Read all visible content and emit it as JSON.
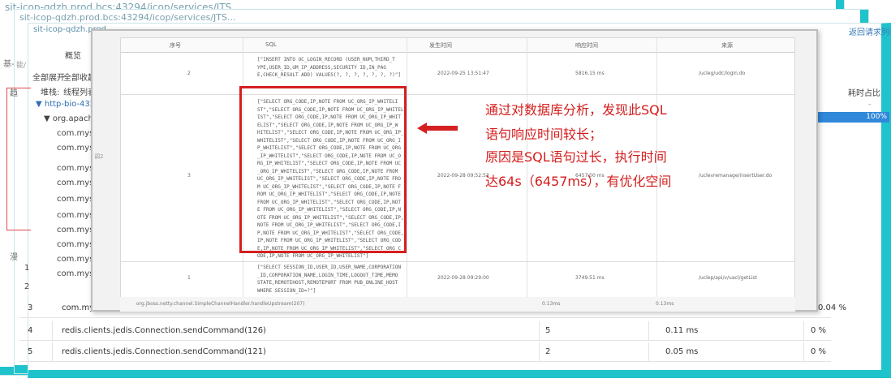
{
  "windows": {
    "w1_title": "sit-icop-qdzh.prod.bcs:43294/icop/services/JTS...",
    "w2_title": "sit-icop-qdzh.prod.bcs:43294/icop/services/JTS...",
    "w3_title": "sit-icop-qdzh.prod"
  },
  "top_right_link": "返回请求列表",
  "left": {
    "tab_label": "概览",
    "expand_all": "全部展开",
    "collapse_all": "全部收起",
    "stack_label": "堆栈:",
    "thread_list": "线程列表",
    "side_base": "基-",
    "side_le": "趋",
    "side_xs": "能/",
    "tree_root": "▼ http-bio-43290",
    "tree_child": "▼ org.apache.ca",
    "rows": [
      "com.mysql",
      "com.mysql",
      "com.mysql",
      "com.mysql",
      "com.mysql",
      "com.mysql",
      "com.mysql",
      "com.mysql",
      "com.mysql",
      "com.mysql"
    ],
    "left_bar_chars": [
      "漫",
      "1",
      "2"
    ],
    "gen_label": "返回"
  },
  "ratio": {
    "header": "耗时占比",
    "dash": "-",
    "bar_label": "100%"
  },
  "bottom_rows": [
    {
      "idx": "3",
      "name": "com.mysq",
      "count": "",
      "time": "",
      "pct": "0.04 %"
    },
    {
      "idx": "4",
      "name": "redis.clients.jedis.Connection.sendCommand(126)",
      "count": "5",
      "time": "0.11 ms",
      "pct": "0 %"
    },
    {
      "idx": "5",
      "name": "redis.clients.jedis.Connection.sendCommand(121)",
      "count": "2",
      "time": "0.05 ms",
      "pct": "0 %"
    }
  ],
  "overlay": {
    "headers": {
      "seq": "序号",
      "sql": "SQL",
      "time": "发生时间",
      "resp": "响应时间",
      "url": "来源"
    },
    "row1": {
      "seq": "2",
      "sql": "[\"INSERT INTO UC_LOGIN_RECORD (USER_NUM,THIRD_T\nYPE,USER_ID,UM_IP_ADDRESS,SECURITY ID,IN_PAG\nE,CHECK_RESULT ADD) VALUES(?, ?, ?, ?, ?, ?, ?)\"]",
      "time": "2022-09-25 13:51:47",
      "resp": "5816.15 ms",
      "url": "/ucleg/udc/logIn.do"
    },
    "row2": {
      "seq": "3",
      "sql": "[\"SELECT ORG_CODE,IP,NOTE FROM UC_ORG_IP_WHITELI\nST\",\"SELECT ORG_CODE,IP,NOTE FROM UC_ORG_IP_WHITEL\nIST\",\"SELECT ORG_CODE,IP,NOTE FROM UC_ORG_IP_WHIT\nELIST\",\"SELECT ORG_CODE,IP,NOTE FROM UC_ORG_IP_W\nHITELIST\",\"SELECT ORG_CODE,IP,NOTE FROM UC_ORG_IP_\nWHITELIST\",\"SELECT ORG_CODE,IP,NOTE FROM UC_ORG_I\nP_WHITELIST\",\"SELECT ORG_CODE,IP,NOTE FROM UC_ORG\n_IP_WHITELIST\",\"SELECT ORG_CODE,IP,NOTE FROM UC_O\nRG_IP_WHITELIST\",\"SELECT ORG_CODE,IP,NOTE FROM UC\n_ORG_IP_WHITELIST\",\"SELECT ORG_CODE,IP,NOTE FROM\nUC_ORG_IP_WHITELIST\",\"SELECT ORG_CODE,IP,NOTE FRO\nM UC_ORG_IP_WHITELIST\",\"SELECT ORG_CODE,IP,NOTE F\nROM UC_ORG_IP_WHITELIST\",\"SELECT ORG_CODE,IP,NOTE\nFROM UC_ORG_IP_WHITELIST\",\"SELECT ORG_CODE,IP,NOT\nE FROM UC_ORG_IP_WHITELIST\",\"SELECT ORG_CODE,IP,N\nOTE FROM UC_ORG_IP_WHITELIST\",\"SELECT ORG_CODE,IP,\nNOTE FROM UC_ORG_IP_WHITELIST\",\"SELECT ORG_CODE,I\nP,NOTE FROM UC_ORG_IP_WHITELIST\",\"SELECT ORG_CODE,\nIP,NOTE FROM UC_ORG_IP_WHITELIST\",\"SELECT ORG_COD\nE,IP,NOTE FROM UC_ORG_IP_WHITELIST\",\"SELECT ORG_C\nODE,IP,NOTE FROM UC_ORG_IP_WHITELIST\"]",
      "time": "2022-09-28 09:52:53",
      "resp": "6457.00 ms",
      "url": "/uclevremanage/insertUser.do"
    },
    "row3": {
      "seq": "1",
      "sql": "[\"SELECT SESSION_ID,USER_ID,USER_NAME,CORPORATION\n_ID,CORPORATION_NAME,LOGIN_TIME,LOGOUT_TIME,MEMO\nSTATE,REMOTEHOST,REMOTEPORT FROM PUB_ONLINE_HOST\nWHERE SESSION_ID=?\"]",
      "time": "2022-09-28 09:29:00",
      "resp": "3749.51 ms",
      "url": "/uclep/api/v/uacl/getList"
    },
    "footer": {
      "path": "org.jboss.netty.channel.SimpleChannelHandler.handleUpstream(207)",
      "a": "0.13ms",
      "b": "0.13ms"
    },
    "side_text": "调2"
  },
  "annotation": {
    "line1": "通过对数据库分析，发现此SQL",
    "line2": "语句响应时间较长；",
    "line3": "原因是SQL语句过长，执行时间",
    "line4": "达64s（6457ms），有优化空间"
  },
  "colors": {
    "accent": "#1fc3cc",
    "highlight": "#d42020",
    "bar": "#2f88d9"
  }
}
